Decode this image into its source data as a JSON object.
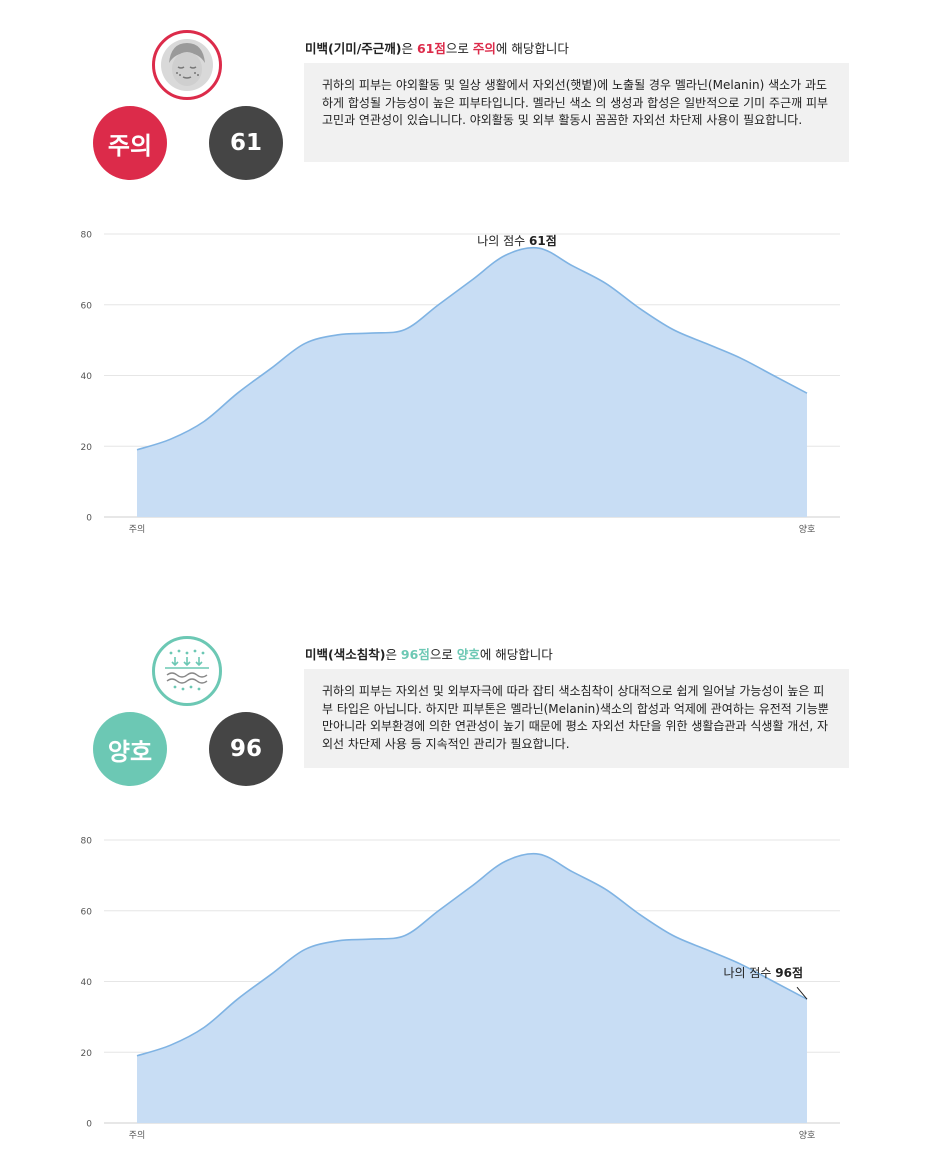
{
  "colors": {
    "caution": "#dc2b4a",
    "good": "#6cc8b4",
    "score_bg": "#454545",
    "area_fill": "#c8ddf4",
    "area_stroke": "#7fb3e3",
    "grid": "#e6e6e6"
  },
  "sections": [
    {
      "icon": "face-spots-icon",
      "level_label": "주의",
      "level_color": "#dc2b4a",
      "score": "61",
      "headline": {
        "title": "미백(기미/주근깨)",
        "part1": "은 ",
        "score_text": "61점",
        "part2": "으로 ",
        "level_text": "주의",
        "part3": "에 해당합니다"
      },
      "description": "귀하의 피부는 야외활동 및 일상 생활에서 자외선(햇볕)에 노출될 경우 멜라닌(Melanin) 색소가 과도하게 합성될 가능성이 높은 피부타입니다. 멜라닌 색소 의 생성과 합성은 일반적으로 기미 주근깨 피부고민과 연관성이 있습니니다. 야외활동 및 외부 활동시 꼼꼼한 자외선 차단제 사용이 필요합니다."
    },
    {
      "icon": "skin-layer-icon",
      "level_label": "양호",
      "level_color": "#6cc8b4",
      "score": "96",
      "headline": {
        "title": "미백(색소침착)",
        "part1": "은 ",
        "score_text": "96점",
        "part2": "으로 ",
        "level_text": "양호",
        "part3": "에 해당합니다"
      },
      "description": "귀하의 피부는 자외선 및 외부자극에 따라 잡티 색소침착이 상대적으로 쉽게 일어날 가능성이 높은 피부 타입은 아닙니다. 하지만 피부톤은 멜라닌(Melanin)색소의 합성과 억제에 관여하는 유전적 기능뿐만아니라 외부환경에 의한 연관성이 높기 때문에 평소 자외선 차단을 위한 생활습관과 식생활 개선, 자외선 차단제 사용 등 지속적인 관리가 필요합니다."
    }
  ],
  "chart_data": [
    {
      "type": "area",
      "x": [
        0,
        0.05,
        0.1,
        0.15,
        0.2,
        0.25,
        0.3,
        0.35,
        0.4,
        0.45,
        0.5,
        0.55,
        0.6,
        0.65,
        0.7,
        0.75,
        0.8,
        0.85,
        0.9,
        0.95,
        1
      ],
      "y": [
        19,
        22,
        27,
        35,
        42,
        49,
        51.5,
        52,
        53,
        60,
        67,
        74,
        76,
        71,
        66,
        59,
        53,
        49,
        45,
        40,
        35
      ],
      "x_tick_labels": [
        "주의",
        "양호"
      ],
      "yticks": [
        0,
        20,
        40,
        60,
        80
      ],
      "ylim": [
        0,
        80
      ],
      "grid": true,
      "annotation": {
        "label": "나의 점수",
        "value": "61점",
        "position": 0.6
      }
    },
    {
      "type": "area",
      "x": [
        0,
        0.05,
        0.1,
        0.15,
        0.2,
        0.25,
        0.3,
        0.35,
        0.4,
        0.45,
        0.5,
        0.55,
        0.6,
        0.65,
        0.7,
        0.75,
        0.8,
        0.85,
        0.9,
        0.95,
        1
      ],
      "y": [
        19,
        22,
        27,
        35,
        42,
        49,
        51.5,
        52,
        53,
        60,
        67,
        74,
        76,
        71,
        66,
        59,
        53,
        49,
        45,
        40,
        35
      ],
      "x_tick_labels": [
        "주의",
        "양호"
      ],
      "yticks": [
        0,
        20,
        40,
        60,
        80
      ],
      "ylim": [
        0,
        80
      ],
      "grid": true,
      "annotation": {
        "label": "나의 점수",
        "value": "96점",
        "position": 1.0
      }
    }
  ]
}
